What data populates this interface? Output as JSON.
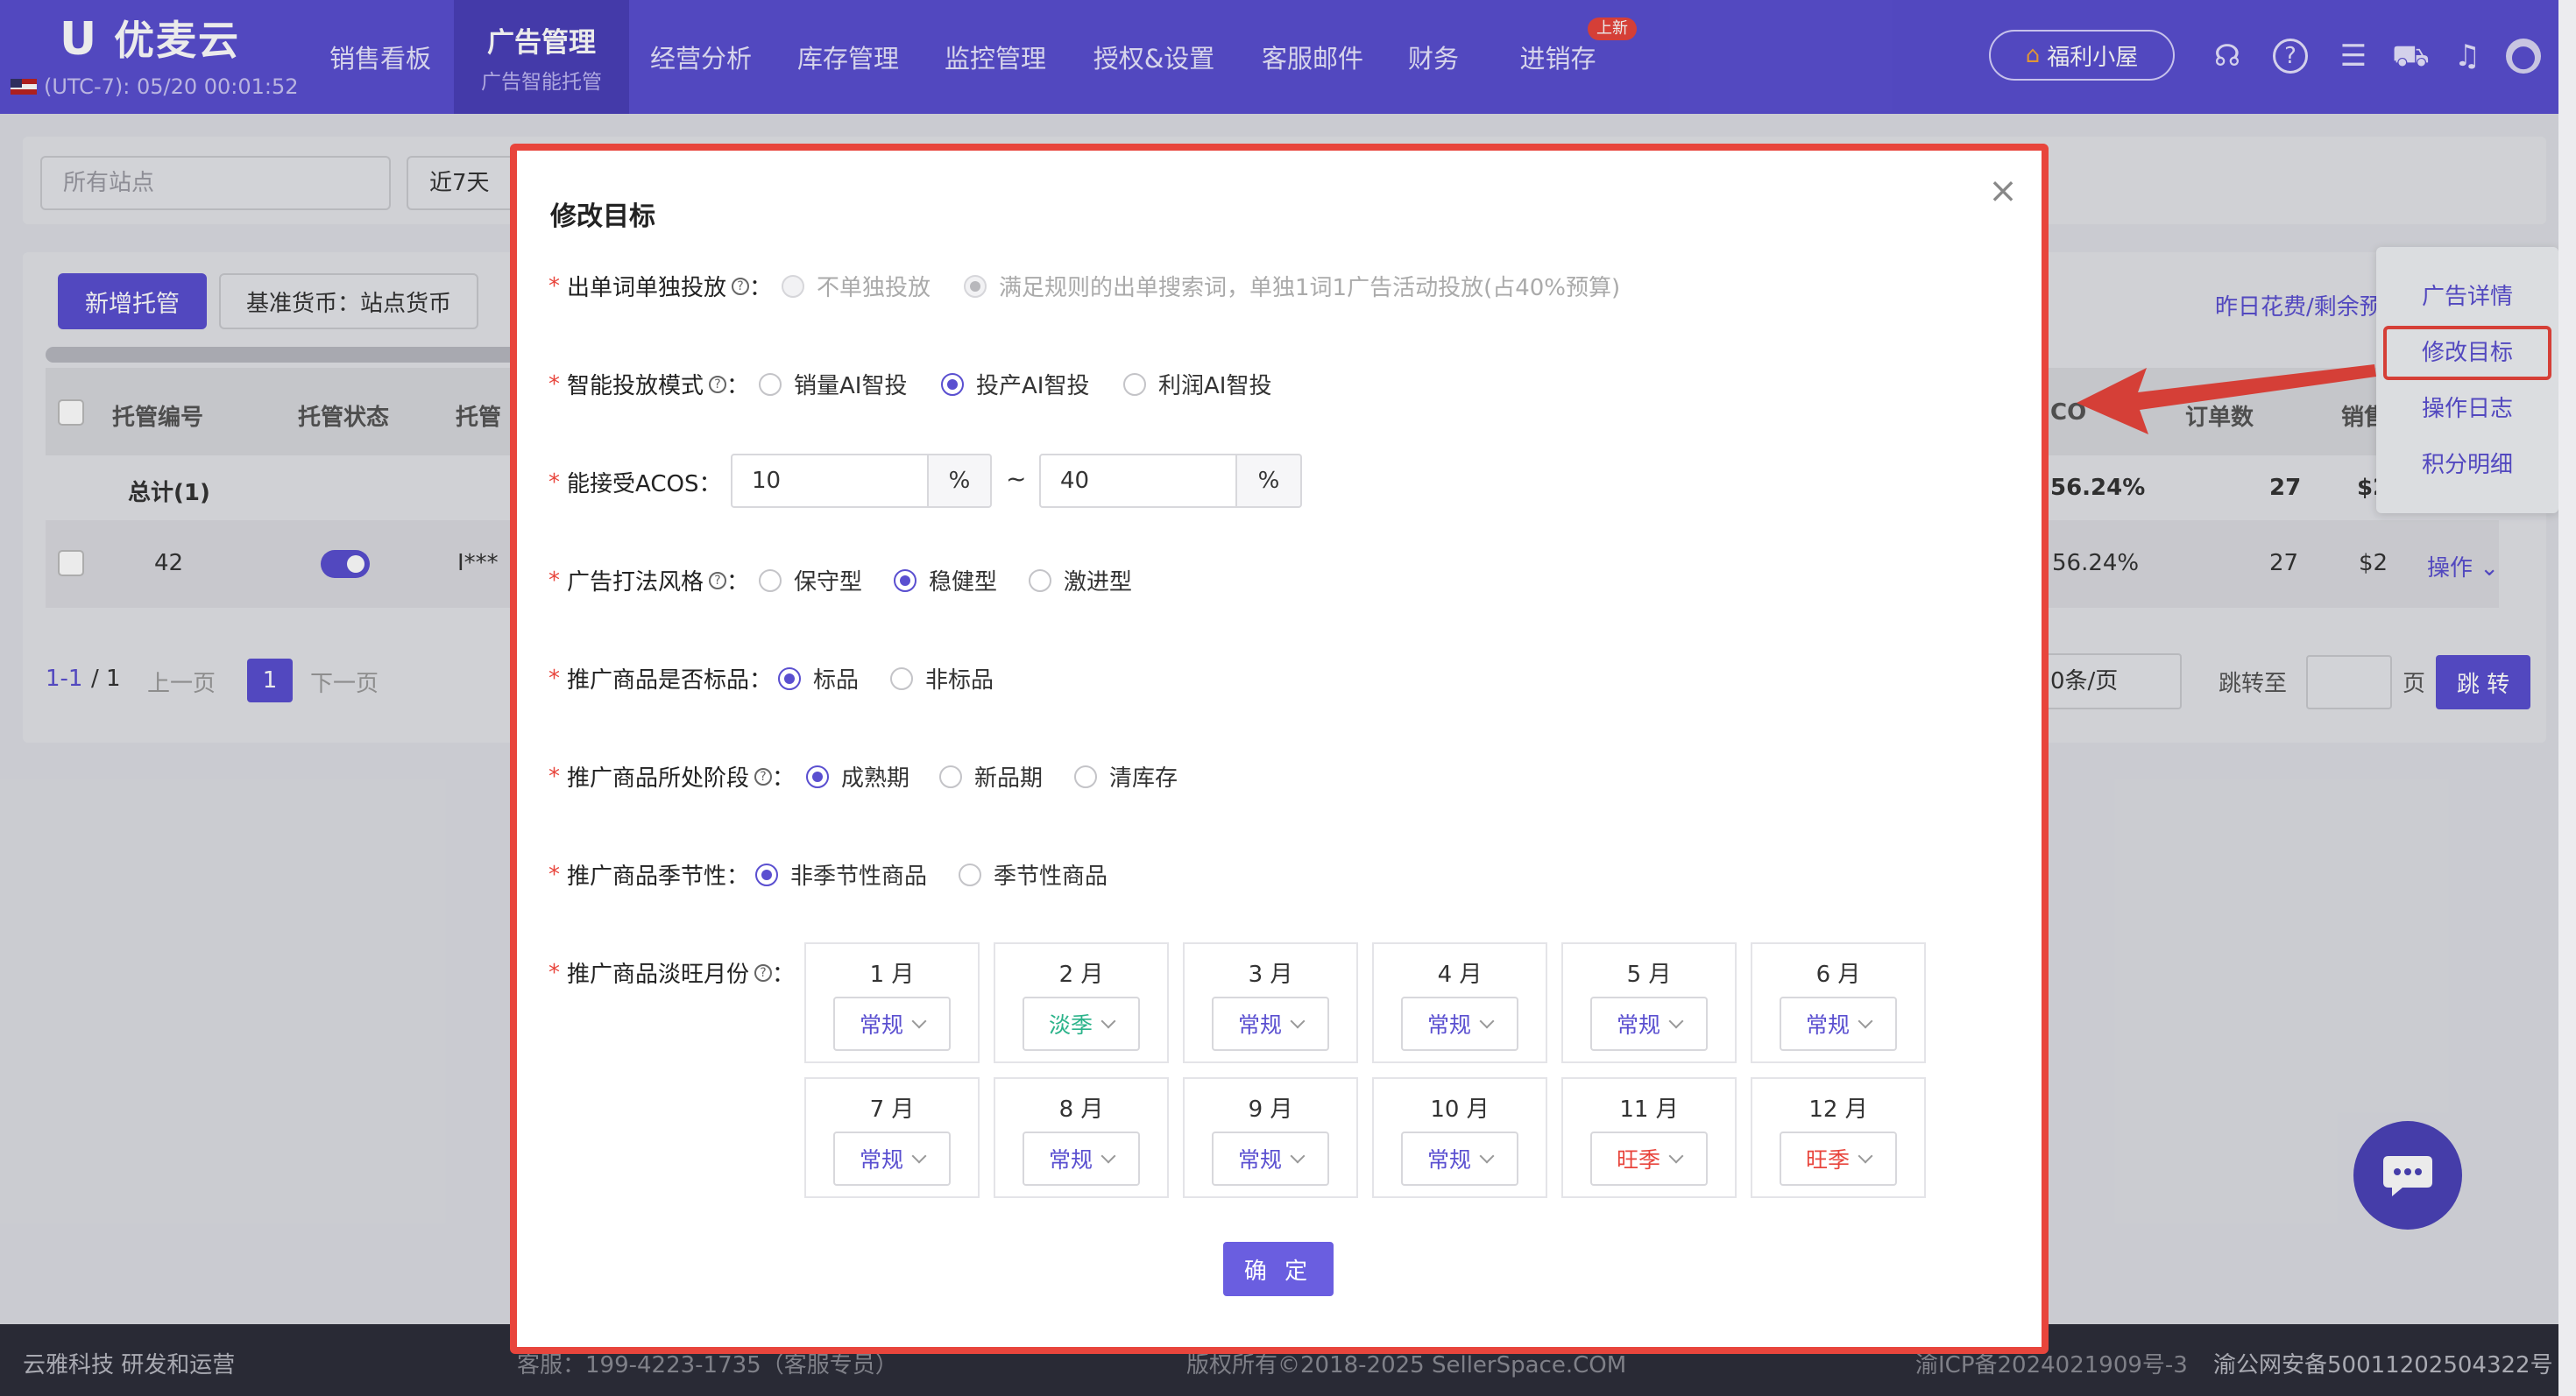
{
  "brand": {
    "logo_text": "优麦云",
    "timezone": "(UTC-7): 05/20 00:01:52"
  },
  "nav": {
    "items": [
      "销售看板",
      "广告管理",
      "经营分析",
      "库存管理",
      "监控管理",
      "授权&设置",
      "客服邮件",
      "财务",
      "进销存"
    ],
    "active_sub": "广告智能托管",
    "new_badge": "上新",
    "welfare": "福利小屋"
  },
  "bg": {
    "site_select": "所有站点",
    "range_select": "近7天",
    "new_btn": "新增托管",
    "currency_btn": "基准货币：站点货币",
    "columns": [
      "托管编号",
      "托管状态",
      "托管",
      "CO",
      "订单数",
      "销售"
    ],
    "right_header": "昨日花费/剩余预",
    "total_label": "总计(1)",
    "total_acos": "56.24%",
    "total_orders": "27",
    "total_sales": "$2",
    "row_id": "42",
    "row_masked": "I***",
    "row_acos": "56.24%",
    "row_orders": "27",
    "row_sales": "$2",
    "row_action": "操作",
    "pager_range": "1-1",
    "pager_total": "/ 1",
    "prev": "上一页",
    "next": "下一页",
    "page": "1",
    "per_page": "0条/页",
    "jump_to": "跳转至",
    "page_unit": "页",
    "jump_btn": "跳 转"
  },
  "menu": [
    "广告详情",
    "修改目标",
    "操作日志",
    "积分明细"
  ],
  "footer": {
    "company": "云雅科技 研发和运营",
    "service": "客服：199-4223-1735（客服专员）",
    "copyright": "版权所有©2018-2025 SellerSpace.COM",
    "icp": "渝ICP备2024021909号-3",
    "police": "渝公网安备50011202504322号"
  },
  "modal": {
    "title": "修改目标",
    "confirm": "确 定",
    "fields": {
      "single": {
        "label": "出单词单独投放",
        "options": [
          "不单独投放",
          "满足规则的出单搜索词，单独1词1广告活动投放(占40%预算)"
        ],
        "selected": 1,
        "disabled": true
      },
      "mode": {
        "label": "智能投放模式",
        "options": [
          "销量AI智投",
          "投产AI智投",
          "利润AI智投"
        ],
        "selected": 1
      },
      "acos": {
        "label": "能接受ACOS",
        "min": "10",
        "max": "40",
        "unit": "%",
        "sep": "~"
      },
      "style": {
        "label": "广告打法风格",
        "options": [
          "保守型",
          "稳健型",
          "激进型"
        ],
        "selected": 1
      },
      "flagship": {
        "label": "推广商品是否标品",
        "options": [
          "标品",
          "非标品"
        ],
        "selected": 0
      },
      "stage": {
        "label": "推广商品所处阶段",
        "options": [
          "成熟期",
          "新品期",
          "清库存"
        ],
        "selected": 0
      },
      "season": {
        "label": "推广商品季节性",
        "options": [
          "非季节性商品",
          "季节性商品"
        ],
        "selected": 0
      },
      "months": {
        "label": "推广商品淡旺月份",
        "items": [
          {
            "month": "1 月",
            "value": "常规"
          },
          {
            "month": "2 月",
            "value": "淡季"
          },
          {
            "month": "3 月",
            "value": "常规"
          },
          {
            "month": "4 月",
            "value": "常规"
          },
          {
            "month": "5 月",
            "value": "常规"
          },
          {
            "month": "6 月",
            "value": "常规"
          },
          {
            "month": "7 月",
            "value": "常规"
          },
          {
            "month": "8 月",
            "value": "常规"
          },
          {
            "month": "9 月",
            "value": "常规"
          },
          {
            "month": "10 月",
            "value": "常规"
          },
          {
            "month": "11 月",
            "value": "旺季"
          },
          {
            "month": "12 月",
            "value": "旺季"
          }
        ]
      }
    }
  },
  "colors": {
    "accent": "#5a4fd0",
    "normal": "#5a4fd0",
    "off_season": "#2bb38a",
    "peak": "#e8453c"
  }
}
